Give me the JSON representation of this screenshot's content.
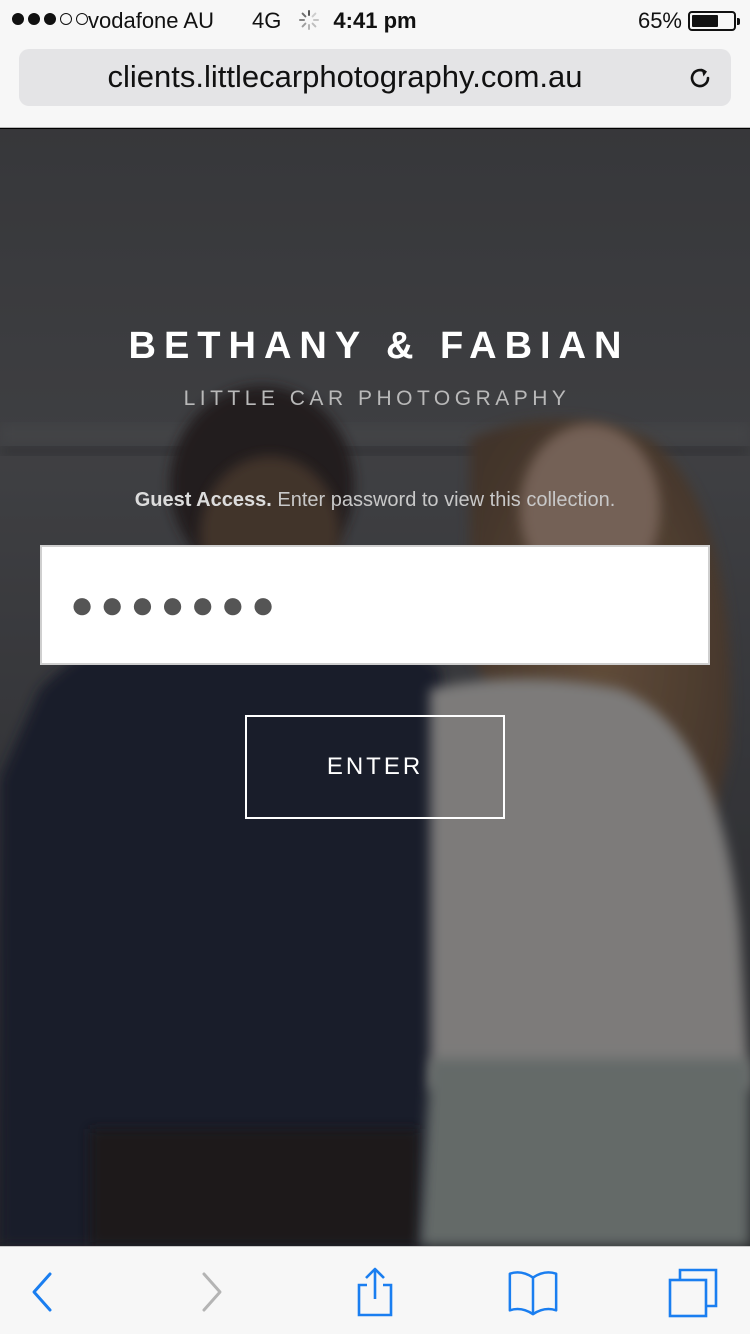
{
  "status_bar": {
    "carrier": "vodafone AU",
    "network": "4G",
    "time": "4:41 pm",
    "battery_percent_text": "65%",
    "battery_level": 0.65,
    "signal_bars_filled": 3,
    "signal_bars_total": 5
  },
  "browser": {
    "url": "clients.littlecarphotography.com.au",
    "reload_icon": "reload-icon",
    "toolbar": {
      "back_icon": "chevron-left-icon",
      "forward_icon": "chevron-right-icon",
      "share_icon": "share-icon",
      "bookmarks_icon": "book-icon",
      "tabs_icon": "tabs-icon"
    }
  },
  "page": {
    "title": "BETHANY & FABIAN",
    "subtitle": "LITTLE CAR PHOTOGRAPHY",
    "guest_label": "Guest Access.",
    "guest_text": "Enter password to view this collection.",
    "password_value": "●●●●●●●",
    "enter_label": "ENTER"
  },
  "colors": {
    "accent": "#1a7ef0",
    "disabled": "#b4b4b4",
    "overlay": "#1e1f22"
  }
}
